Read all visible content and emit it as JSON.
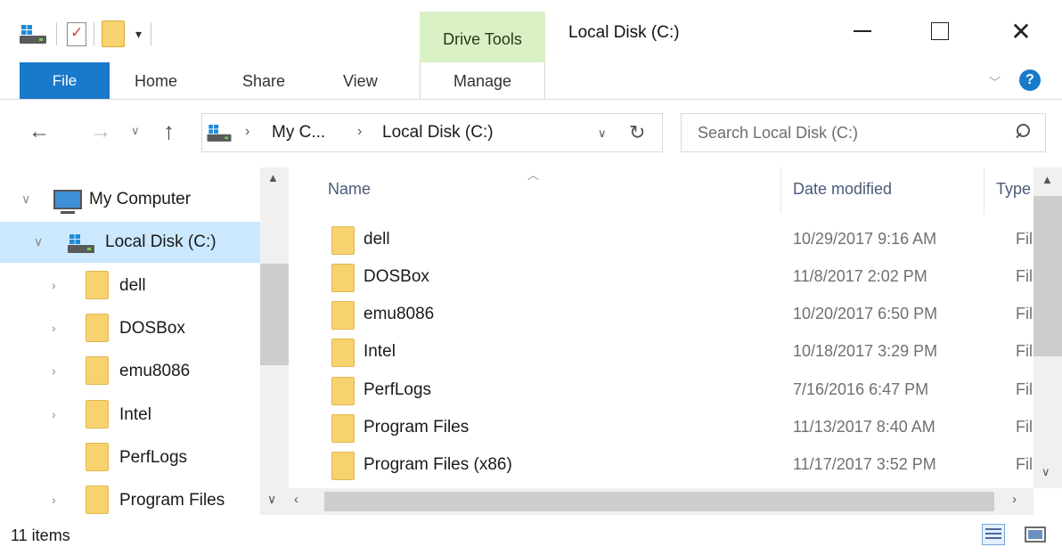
{
  "window": {
    "title": "Local Disk (C:)",
    "context_tab_group": "Drive Tools"
  },
  "ribbon": {
    "tabs": [
      {
        "label": "File"
      },
      {
        "label": "Home"
      },
      {
        "label": "Share"
      },
      {
        "label": "View"
      },
      {
        "label": "Manage"
      }
    ],
    "help": "?"
  },
  "address": {
    "crumbs": [
      "My C...",
      "Local Disk (C:)"
    ],
    "search_placeholder": "Search Local Disk (C:)"
  },
  "nav_pane": {
    "items": [
      {
        "label": "My Computer",
        "icon": "computer-icon"
      },
      {
        "label": "Local Disk (C:)",
        "icon": "drive-icon"
      },
      {
        "label": "dell",
        "icon": "folder-icon"
      },
      {
        "label": "DOSBox",
        "icon": "folder-icon"
      },
      {
        "label": "emu8086",
        "icon": "folder-icon"
      },
      {
        "label": "Intel",
        "icon": "folder-icon"
      },
      {
        "label": "PerfLogs",
        "icon": "folder-icon"
      },
      {
        "label": "Program Files",
        "icon": "folder-icon"
      }
    ]
  },
  "file_list": {
    "columns": {
      "name": "Name",
      "date": "Date modified",
      "type": "Type"
    },
    "rows": [
      {
        "name": "dell",
        "date": "10/29/2017 9:16 AM",
        "type": "File folder"
      },
      {
        "name": "DOSBox",
        "date": "11/8/2017 2:02 PM",
        "type": "File folder"
      },
      {
        "name": "emu8086",
        "date": "10/20/2017 6:50 PM",
        "type": "File folder"
      },
      {
        "name": "Intel",
        "date": "10/18/2017 3:29 PM",
        "type": "File folder"
      },
      {
        "name": "PerfLogs",
        "date": "7/16/2016 6:47 PM",
        "type": "File folder"
      },
      {
        "name": "Program Files",
        "date": "11/13/2017 8:40 AM",
        "type": "File folder"
      },
      {
        "name": "Program Files (x86)",
        "date": "11/17/2017 3:52 PM",
        "type": "File folder"
      }
    ]
  },
  "status": {
    "item_count": "11 items"
  },
  "colors": {
    "file_tab": "#1979ca",
    "drive_tools": "#daf1c6",
    "selected": "#cce8ff",
    "folder": "#f7d26e"
  }
}
